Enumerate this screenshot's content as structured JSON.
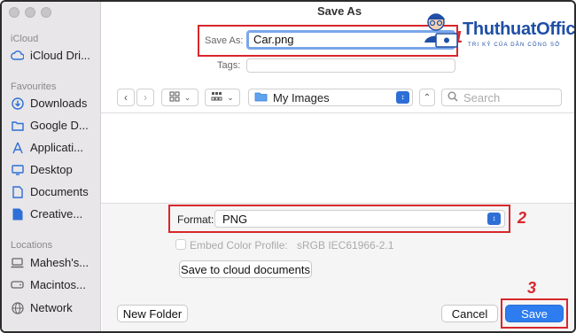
{
  "window": {
    "title": "Save As"
  },
  "sidebar": {
    "sections": [
      {
        "label": "iCloud"
      },
      {
        "label": "Favourites"
      },
      {
        "label": "Locations"
      }
    ],
    "items": [
      {
        "label": "iCloud Dri...",
        "icon": "cloud-icon"
      },
      {
        "label": "Downloads",
        "icon": "download-icon"
      },
      {
        "label": "Google D...",
        "icon": "folder-icon"
      },
      {
        "label": "Applicati...",
        "icon": "applications-icon"
      },
      {
        "label": "Desktop",
        "icon": "desktop-icon"
      },
      {
        "label": "Documents",
        "icon": "documents-icon"
      },
      {
        "label": "Creative...",
        "icon": "file-icon"
      },
      {
        "label": "Mahesh's...",
        "icon": "laptop-icon"
      },
      {
        "label": "Macintos...",
        "icon": "disk-icon"
      },
      {
        "label": "Network",
        "icon": "globe-icon"
      }
    ]
  },
  "save_as": {
    "label": "Save As:",
    "value": "Car.png"
  },
  "tags": {
    "label": "Tags:",
    "value": ""
  },
  "location": {
    "value": "My Images"
  },
  "search": {
    "placeholder": "Search"
  },
  "format": {
    "label": "Format:",
    "value": "PNG"
  },
  "embed_profile": {
    "label": "Embed Color Profile:",
    "value": "sRGB IEC61966-2.1"
  },
  "buttons": {
    "cloud": "Save to cloud documents",
    "new_folder": "New Folder",
    "cancel": "Cancel",
    "save": "Save"
  },
  "annotations": {
    "one": "1",
    "two": "2",
    "three": "3"
  },
  "watermark": {
    "brand": "ThuthuatOffice",
    "tagline": "TRI KỶ CỦA DÂN CÔNG SỞ"
  },
  "colors": {
    "highlight": "#d8262c",
    "accent": "#2d7cf0",
    "brand": "#1f4fa6"
  }
}
